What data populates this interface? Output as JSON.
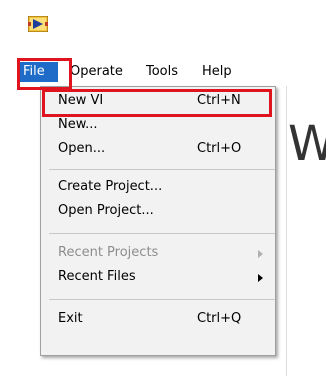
{
  "menubar": {
    "items": [
      {
        "label": "File",
        "active": true
      },
      {
        "label": "Operate",
        "active": false
      },
      {
        "label": "Tools",
        "active": false
      },
      {
        "label": "Help",
        "active": false
      }
    ]
  },
  "background_text": "W",
  "file_menu": {
    "items": [
      {
        "label": "New VI",
        "shortcut": "Ctrl+N",
        "disabled": false
      },
      {
        "label": "New...",
        "shortcut": "",
        "disabled": false
      },
      {
        "label": "Open...",
        "shortcut": "Ctrl+O",
        "disabled": false
      },
      {
        "label": "Create Project...",
        "shortcut": "",
        "disabled": false
      },
      {
        "label": "Open Project...",
        "shortcut": "",
        "disabled": false
      },
      {
        "label": "Recent Projects",
        "shortcut": "",
        "disabled": true,
        "submenu": true
      },
      {
        "label": "Recent Files",
        "shortcut": "",
        "disabled": false,
        "submenu": true
      },
      {
        "label": "Exit",
        "shortcut": "Ctrl+Q",
        "disabled": false
      }
    ]
  },
  "colors": {
    "menu_highlight": "#1e6cc8",
    "annotation_box": "#e0141e",
    "menu_background": "#f2f2f2"
  },
  "icons": {
    "app_icon": "labview-app-icon",
    "submenu_arrow": "chevron-right-icon"
  }
}
